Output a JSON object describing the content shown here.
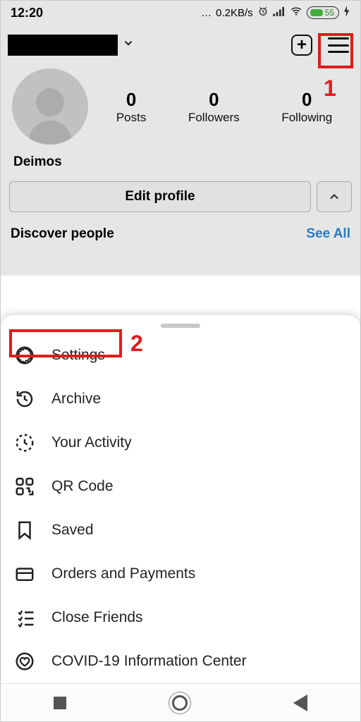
{
  "status": {
    "time": "12:20",
    "net_speed": "0.2KB/s",
    "battery_pct": "55"
  },
  "profile": {
    "display_name": "Deimos",
    "stats": {
      "posts_count": "0",
      "posts_label": "Posts",
      "followers_count": "0",
      "followers_label": "Followers",
      "following_count": "0",
      "following_label": "Following"
    },
    "edit_label": "Edit profile"
  },
  "discover": {
    "title": "Discover people",
    "see_all": "See All"
  },
  "menu": {
    "settings": "Settings",
    "archive": "Archive",
    "activity": "Your Activity",
    "qr": "QR Code",
    "saved": "Saved",
    "orders": "Orders and Payments",
    "close_friends": "Close Friends",
    "covid": "COVID-19 Information Center"
  },
  "annotations": {
    "step1": "1",
    "step2": "2"
  }
}
